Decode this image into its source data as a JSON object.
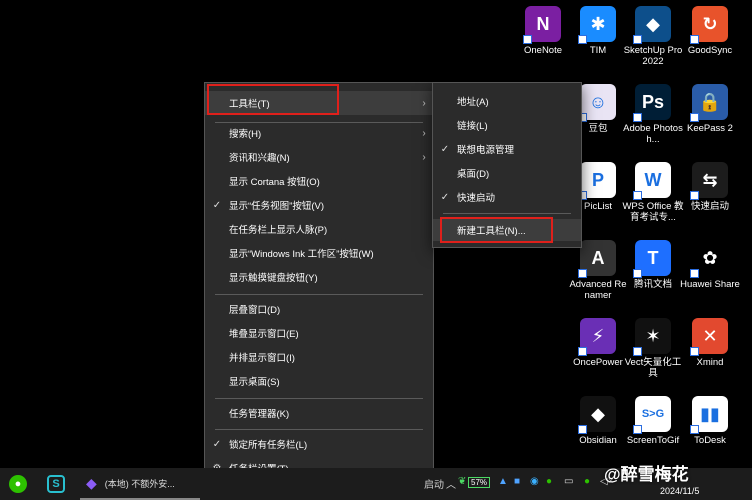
{
  "desktop_icons": [
    {
      "id": "onenote",
      "label": "OneNote",
      "glyph": "N",
      "color": "#7b1fa2"
    },
    {
      "id": "tim",
      "label": "TIM",
      "glyph": "✱",
      "color": "#1a8cff"
    },
    {
      "id": "sketchup",
      "label": "SketchUp Pro 2022",
      "glyph": "◆",
      "color": "#0d4f8b"
    },
    {
      "id": "goodsync",
      "label": "GoodSync",
      "glyph": "↻",
      "color": "#e8532b"
    },
    {
      "id": "doubao",
      "label": "豆包",
      "glyph": "☺",
      "color": "#e9e4f4"
    },
    {
      "id": "photoshop",
      "label": "Adobe Photosh...",
      "glyph": "Ps",
      "color": "#001e36"
    },
    {
      "id": "keepass",
      "label": "KeePass 2",
      "glyph": "🔒",
      "color": "#2a5ca8"
    },
    {
      "id": "piclist",
      "label": "PicList",
      "glyph": "P",
      "color": "#ffffff"
    },
    {
      "id": "wps",
      "label": "WPS Office 教育考试专...",
      "glyph": "W",
      "color": "#ffffff"
    },
    {
      "id": "kuaisu",
      "label": "快速启动",
      "glyph": "⇆",
      "color": "#1c1c1c"
    },
    {
      "id": "renamer",
      "label": "Advanced Renamer",
      "glyph": "A",
      "color": "#333333"
    },
    {
      "id": "tencentdocs",
      "label": "腾讯文档",
      "glyph": "T",
      "color": "#1e6fff"
    },
    {
      "id": "huawei",
      "label": "Huawei Share",
      "glyph": "✿",
      "color": "#000000"
    },
    {
      "id": "oncepower",
      "label": "OncePower",
      "glyph": "⚡",
      "color": "#6a2fb5"
    },
    {
      "id": "vect",
      "label": "Vect矢量化工具",
      "glyph": "✶",
      "color": "#111111"
    },
    {
      "id": "xmind",
      "label": "Xmind",
      "glyph": "✕",
      "color": "#e2492f"
    },
    {
      "id": "obsidian",
      "label": "Obsidian",
      "glyph": "◆",
      "color": "#111111"
    },
    {
      "id": "screentogif",
      "label": "ScreenToGif",
      "glyph": "S>G",
      "color": "#ffffff"
    },
    {
      "id": "todesk",
      "label": "ToDesk",
      "glyph": "▮▮",
      "color": "#ffffff"
    }
  ],
  "main_menu": {
    "items": [
      {
        "label": "工具栏(T)",
        "submenu": true,
        "checked": false
      },
      {
        "label": "搜索(H)",
        "submenu": true,
        "checked": false
      },
      {
        "label": "资讯和兴趣(N)",
        "submenu": true,
        "checked": false
      },
      {
        "label": "显示 Cortana 按钮(O)",
        "submenu": false,
        "checked": false
      },
      {
        "label": "显示“任务视图”按钮(V)",
        "submenu": false,
        "checked": true
      },
      {
        "label": "在任务栏上显示人脉(P)",
        "submenu": false,
        "checked": false
      },
      {
        "label": "显示“Windows Ink 工作区”按钮(W)",
        "submenu": false,
        "checked": false
      },
      {
        "label": "显示触摸键盘按钮(Y)",
        "submenu": false,
        "checked": false
      },
      {
        "label": "层叠窗口(D)",
        "submenu": false,
        "checked": false
      },
      {
        "label": "堆叠显示窗口(E)",
        "submenu": false,
        "checked": false
      },
      {
        "label": "并排显示窗口(I)",
        "submenu": false,
        "checked": false
      },
      {
        "label": "显示桌面(S)",
        "submenu": false,
        "checked": false
      },
      {
        "label": "任务管理器(K)",
        "submenu": false,
        "checked": false
      },
      {
        "label": "锁定所有任务栏(L)",
        "submenu": false,
        "checked": true
      },
      {
        "label": "任务栏设置(T)",
        "submenu": false,
        "checked": false,
        "icon": "gear-icon"
      }
    ]
  },
  "toolbar_submenu": {
    "items": [
      {
        "label": "地址(A)",
        "checked": false
      },
      {
        "label": "链接(L)",
        "checked": false
      },
      {
        "label": "联想电源管理",
        "checked": true
      },
      {
        "label": "桌面(D)",
        "checked": false
      },
      {
        "label": "快速启动",
        "checked": true
      },
      {
        "label": "新建工具栏(N)...",
        "checked": false
      }
    ]
  },
  "taskbar": {
    "window_title": "(本地) 不额外安...",
    "partial_label": "启动",
    "battery": "57%",
    "icons": [
      "wechat-icon",
      "s-app-icon",
      "obsidian-icon"
    ]
  },
  "watermark": {
    "text": "@醉雪梅花",
    "date": "2024/11/5"
  }
}
